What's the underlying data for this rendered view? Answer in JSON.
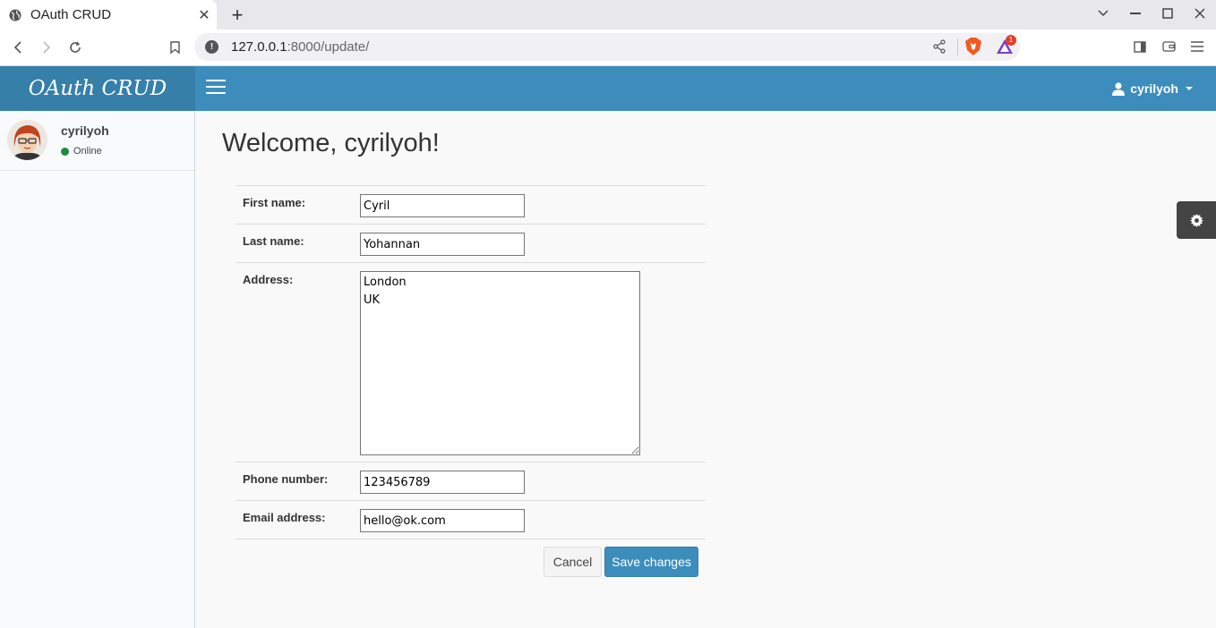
{
  "browser": {
    "tab_title": "OAuth CRUD",
    "tab_close": "✕",
    "new_tab": "+",
    "url_host": "127.0.0.1",
    "url_rest": ":8000/update/",
    "rewards_badge": "1"
  },
  "app": {
    "logo": "OAuth CRUD",
    "user_menu_label": "cyrilyoh"
  },
  "sidebar": {
    "user_name": "cyrilyoh",
    "status": "Online",
    "status_color": "#1e8a3e"
  },
  "page": {
    "title": "Welcome, cyrilyoh!"
  },
  "form": {
    "first_name_label": "First name:",
    "first_name_value": "Cyril",
    "last_name_label": "Last name:",
    "last_name_value": "Yohannan",
    "address_label": "Address:",
    "address_value": "London\nUK",
    "phone_label": "Phone number:",
    "phone_value": "123456789",
    "email_label": "Email address:",
    "email_value": "hello@ok.com",
    "cancel_label": "Cancel",
    "save_label": "Save changes"
  },
  "colors": {
    "header_blue": "#3c8dbc",
    "logo_blue": "#367fa9"
  },
  "icons": [
    "globe-icon",
    "close-icon",
    "plus-icon",
    "back-icon",
    "forward-icon",
    "reload-icon",
    "bookmark-icon",
    "info-icon",
    "share-icon",
    "brave-shield-icon",
    "rewards-icon",
    "sidebar-icon",
    "wallet-icon",
    "menu-icon",
    "hamburger-icon",
    "user-icon",
    "gear-icon"
  ]
}
